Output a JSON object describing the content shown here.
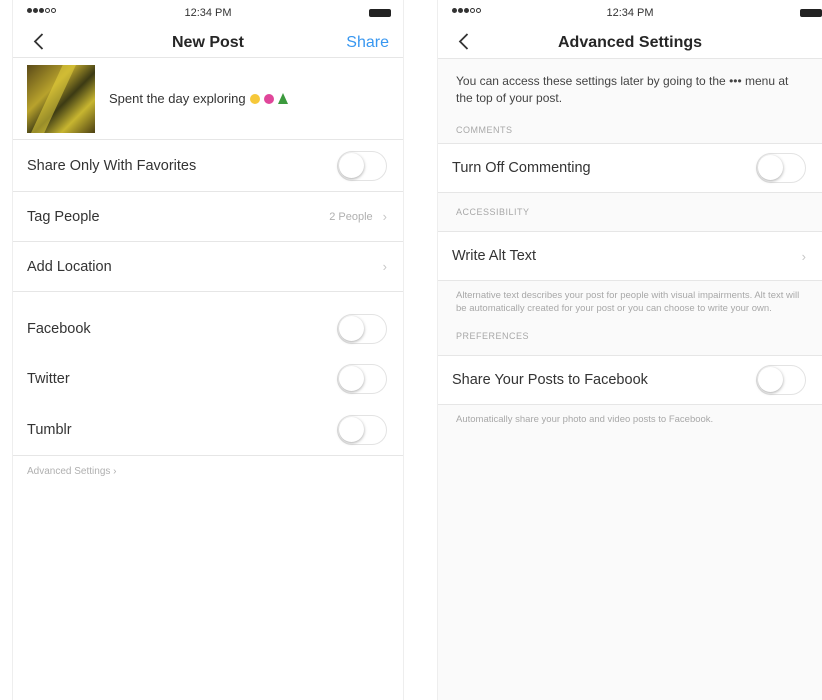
{
  "left": {
    "status": {
      "time": "12:34 PM"
    },
    "nav": {
      "title": "New Post",
      "share_label": "Share"
    },
    "caption": "Spent the day exploring",
    "rows": {
      "favorites": "Share Only With Favorites",
      "tag_people": "Tag People",
      "tag_people_value": "2 People",
      "add_location": "Add Location",
      "facebook": "Facebook",
      "twitter": "Twitter",
      "tumblr": "Tumblr"
    },
    "advanced_link": "Advanced Settings ›"
  },
  "right": {
    "status": {
      "time": "12:34 PM"
    },
    "nav": {
      "title": "Advanced Settings"
    },
    "intro": "You can access these settings later by going to the ••• menu at the top of your post.",
    "sections": {
      "comments": "COMMENTS",
      "accessibility": "ACCESSIBILITY",
      "preferences": "PREFERENCES"
    },
    "rows": {
      "turn_off_commenting": "Turn Off Commenting",
      "write_alt_text": "Write Alt Text",
      "share_to_facebook": "Share Your Posts to Facebook"
    },
    "alt_text_desc": "Alternative text describes your post for people with visual impairments. Alt text will be automatically created for your post or you can choose to write your own.",
    "facebook_desc": "Automatically share your photo and video posts to Facebook."
  },
  "colors": {
    "accent": "#3897f0",
    "text": "#262626",
    "muted": "#a8a8a8",
    "divider": "#e6e6e6"
  },
  "icons": [
    "back-chevron-icon",
    "chevron-right-icon",
    "battery-icon",
    "signal-icon"
  ]
}
